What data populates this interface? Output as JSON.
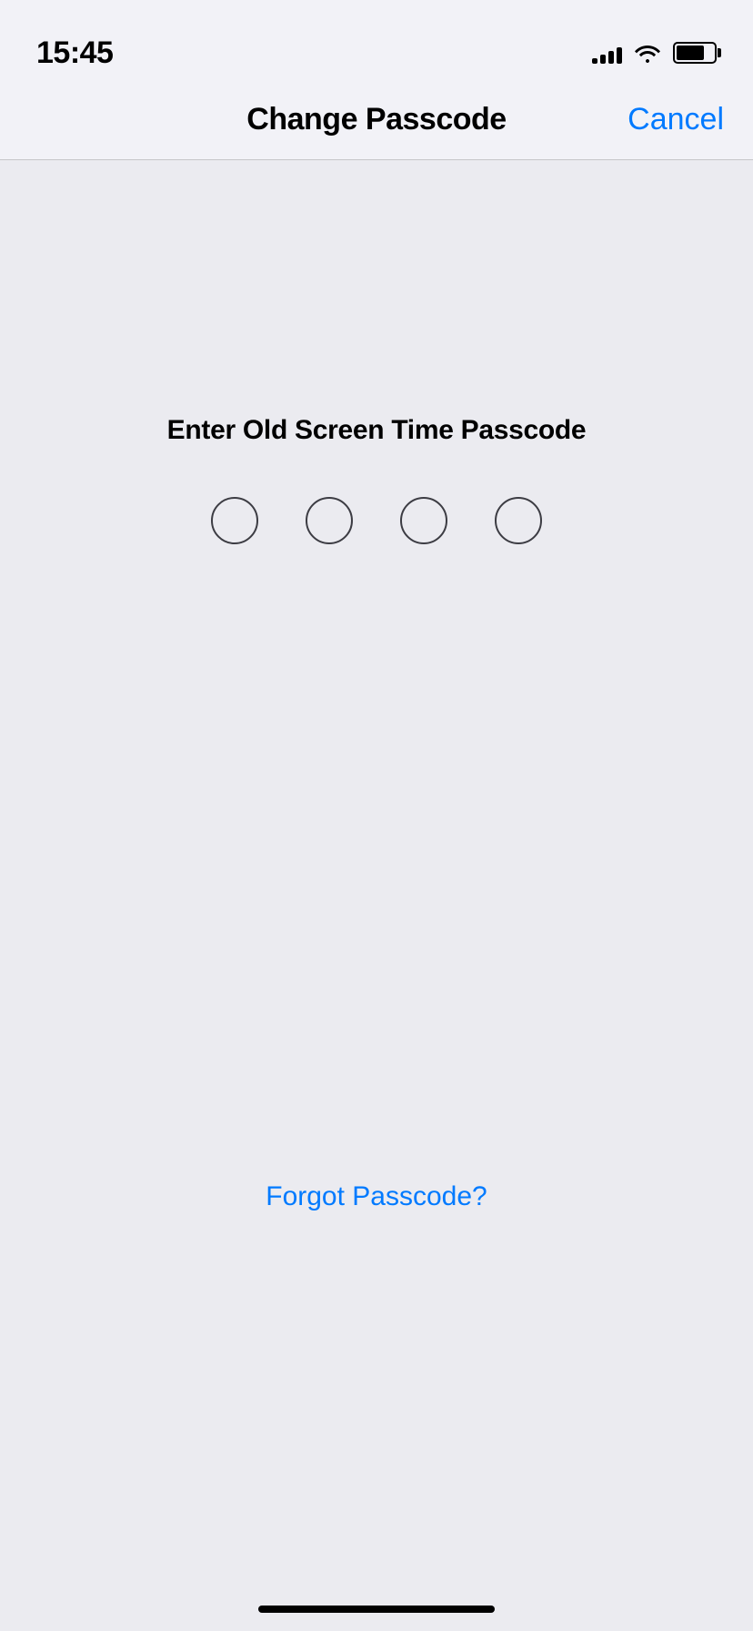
{
  "statusBar": {
    "time": "15:45",
    "signalBars": [
      6,
      10,
      14,
      18,
      22
    ],
    "battery": 75
  },
  "navBar": {
    "title": "Change Passcode",
    "cancelLabel": "Cancel"
  },
  "main": {
    "promptText": "Enter Old Screen Time Passcode",
    "dots": [
      {
        "filled": false
      },
      {
        "filled": false
      },
      {
        "filled": false
      },
      {
        "filled": false
      }
    ],
    "forgotLabel": "Forgot Passcode?"
  },
  "colors": {
    "accent": "#007aff",
    "background": "#ebebf0",
    "navBackground": "#f2f2f7"
  }
}
